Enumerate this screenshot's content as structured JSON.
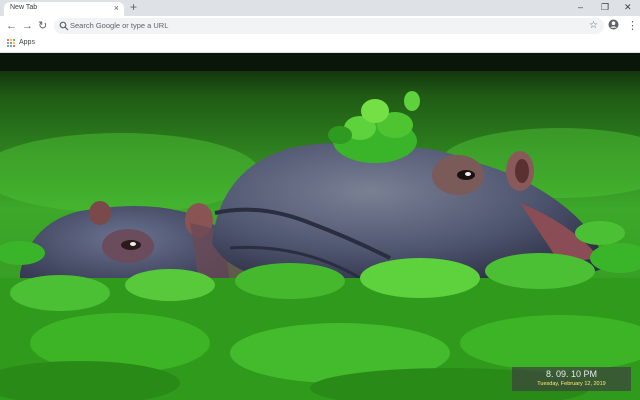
{
  "tab": {
    "title": "New Tab",
    "close_symbol": "×",
    "new_tab_symbol": "+"
  },
  "window": {
    "minimize": "–",
    "maximize": "❐",
    "close": "✕"
  },
  "toolbar": {
    "back": "←",
    "forward": "→",
    "reload": "↻",
    "star": "☆",
    "menu": "⋮"
  },
  "omnibox": {
    "placeholder": "Search Google or type a URL"
  },
  "bookmarks": {
    "apps_label": "Apps"
  },
  "clock": {
    "time": "8. 09. 10 PM",
    "date": "Tuesday, February 12, 2019"
  },
  "colors": {
    "apps_dots": [
      "#ea4335",
      "#fbbc05",
      "#34a853",
      "#4285f4",
      "#ea4335",
      "#fbbc05",
      "#34a853",
      "#4285f4",
      "#ea4335"
    ],
    "grass": "#3fa81e",
    "hippo": "#5a5f75"
  },
  "background": {
    "subject": "hippos-in-water-lettuce"
  }
}
